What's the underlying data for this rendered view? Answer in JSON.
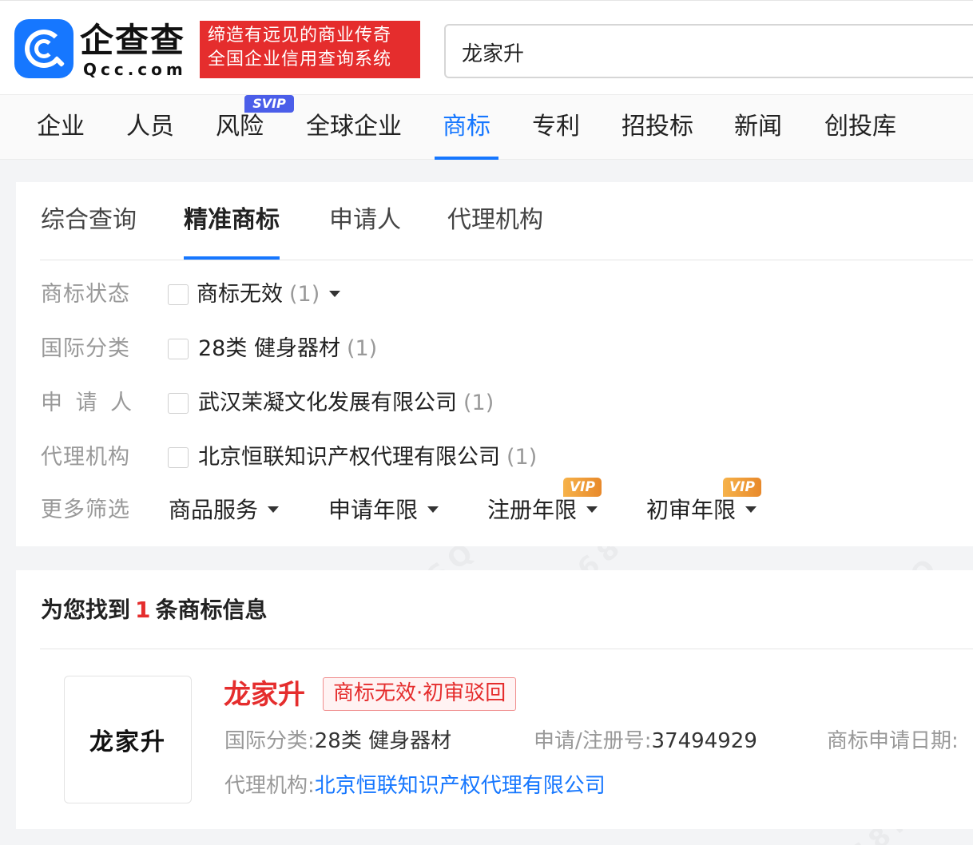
{
  "header": {
    "logo_cn": "企查查",
    "logo_en": "Qcc.com",
    "slogan_line1": "缔造有远见的商业传奇",
    "slogan_line2": "全国企业信用查询系统",
    "search_value": "龙家升"
  },
  "main_nav": {
    "items": [
      "企业",
      "人员",
      "风险",
      "全球企业",
      "商标",
      "专利",
      "招投标",
      "新闻",
      "创投库"
    ],
    "active": "商标",
    "svip_badge": "SVIP"
  },
  "subtabs": {
    "items": [
      "综合查询",
      "精准商标",
      "申请人",
      "代理机构"
    ],
    "active": "精准商标"
  },
  "filters": [
    {
      "label": "商标状态",
      "option": "商标无效",
      "count": "(1)",
      "has_dropdown": true
    },
    {
      "label": "国际分类",
      "option": "28类 健身器材",
      "count": "(1)",
      "has_dropdown": false
    },
    {
      "label": "申 请 人",
      "option": "武汉茉凝文化发展有限公司",
      "count": "(1)",
      "has_dropdown": false
    },
    {
      "label": "代理机构",
      "option": "北京恒联知识产权代理有限公司",
      "count": "(1)",
      "has_dropdown": false
    }
  ],
  "more_filters": {
    "label": "更多筛选",
    "dropdowns": [
      "商品服务",
      "申请年限",
      "注册年限",
      "初审年限"
    ],
    "vip_badge": "VIP"
  },
  "results": {
    "prefix": "为您找到",
    "count": "1",
    "suffix": "条商标信息",
    "items": [
      {
        "thumb_text": "龙家升",
        "name": "龙家升",
        "status": "商标无效·初审驳回",
        "class_label": "国际分类:",
        "class_value": "28类 健身器材",
        "reg_label": "申请/注册号:",
        "reg_value": "37494929",
        "date_label": "商标申请日期:",
        "agency_label": "代理机构:",
        "agency_value": "北京恒联知识产权代理有限公司"
      }
    ]
  },
  "colors": {
    "primary": "#1677ff",
    "danger": "#e52d2d",
    "svip": "#4b5ee9",
    "vip": "#f0a03a"
  },
  "icons": [
    "qcc-logo-icon",
    "checkbox-icon",
    "caret-down-icon"
  ]
}
